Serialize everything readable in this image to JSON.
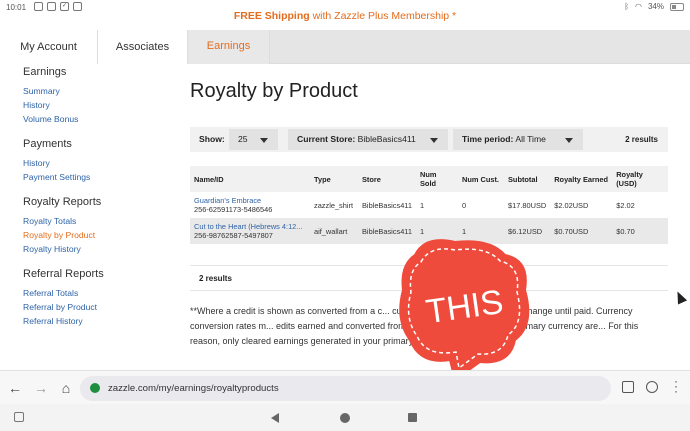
{
  "status": {
    "time": "10:01",
    "battery": "34%"
  },
  "promo": {
    "bold": "FREE Shipping",
    "rest": " with Zazzle Plus Membership *"
  },
  "tabs": [
    {
      "label": "My Account"
    },
    {
      "label": "Associates"
    },
    {
      "label": "Earnings"
    }
  ],
  "sidebar": {
    "earnings": {
      "heading": "Earnings",
      "items": [
        "Summary",
        "History",
        "Volume Bonus"
      ]
    },
    "payments": {
      "heading": "Payments",
      "items": [
        "History",
        "Payment Settings"
      ]
    },
    "royalty": {
      "heading": "Royalty Reports",
      "items": [
        "Royalty Totals",
        "Royalty by Product",
        "Royalty History"
      ]
    },
    "referral": {
      "heading": "Referral Reports",
      "items": [
        "Referral Totals",
        "Referral by Product",
        "Referral History"
      ]
    }
  },
  "main": {
    "title": "Royalty by Product",
    "filters": {
      "show_label": "Show:",
      "show_value": "25",
      "store_label": "Current Store:",
      "store_value": "BibleBasics411",
      "time_label": "Time period:",
      "time_value": "All Time",
      "results": "2 results"
    },
    "table": {
      "headers": [
        "Name/ID",
        "Type",
        "Store",
        "Num Sold",
        "Num Cust.",
        "Subtotal",
        "Royalty Earned",
        "Royalty (USD)"
      ],
      "rows": [
        {
          "name": "Guardian's Embrace",
          "id": "256-62591173-5486546",
          "type": "zazzle_shirt",
          "store": "BibleBasics411",
          "sold": "1",
          "cust": "0",
          "subtotal": "$17.80USD",
          "earned": "$2.02USD",
          "usd": "$2.02"
        },
        {
          "name": "Cut to the Heart (Hebrews 4:12...",
          "id": "256-98762587-5497807",
          "type": "aif_wallart",
          "store": "BibleBasics411",
          "sold": "1",
          "cust": "1",
          "subtotal": "$6.12USD",
          "earned": "$0.70USD",
          "usd": "$0.70"
        }
      ]
    },
    "bottom_results": "2 results",
    "note": "**Where a credit is shown as converted from a c... currency, that credit is subject to change until paid. Currency conversion rates m... edits earned and converted from a currency other than your primary currency are... For this reason, only cleared earnings generated in your primary currency ma... site."
  },
  "sticker": {
    "text": "THIS",
    "color": "#ef4b3c"
  },
  "browser": {
    "url": "zazzle.com/my/earnings/royaltyproducts"
  }
}
